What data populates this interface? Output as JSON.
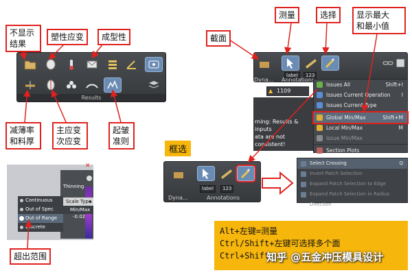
{
  "callouts": {
    "hide_result": "不显示\n结果",
    "plastic_strain": "塑性应变",
    "formability": "成型性",
    "thinning": "减薄率\n和料厚",
    "major_minor_strain": "主应变\n次应变",
    "wrinkle_criterion": "起皱\n准则",
    "section": "截面",
    "measure": "测量",
    "select": "选择",
    "show_minmax": "显示最大\n和最小值",
    "box_select": "框选",
    "out_of_range": "超出范围"
  },
  "toolbars": {
    "results_label": "Results",
    "annotations_label": "Annotations",
    "dyna_label": "Dyna...",
    "issue_count": "1109",
    "counter_value": "123",
    "label_tag": "label"
  },
  "warning_text": "rning: Results & inputs\nata are not consistent!",
  "selection_menu": {
    "items": [
      {
        "label": "Issues All",
        "shortcut": "Shift+I",
        "disabled": false,
        "highlight": false,
        "color": "#6ab04c"
      },
      {
        "label": "Issues Current Operation",
        "shortcut": "I",
        "disabled": false,
        "highlight": false,
        "color": "#5a8fd8"
      },
      {
        "label": "Issues Current Type",
        "shortcut": "",
        "disabled": false,
        "highlight": false,
        "color": "#5a8fd8"
      },
      {
        "label": "Global Min/Max",
        "shortcut": "Shift+M",
        "disabled": false,
        "highlight": true,
        "color": "#e0b030"
      },
      {
        "label": "Local Min/Max",
        "shortcut": "M",
        "disabled": false,
        "highlight": false,
        "color": "#e0b030"
      },
      {
        "label": "Issue Min/Max",
        "shortcut": "",
        "disabled": true,
        "highlight": false,
        "color": "#8a8a8a"
      },
      {
        "label": "Section Plots",
        "shortcut": "",
        "disabled": false,
        "highlight": false,
        "color": "#c06060"
      }
    ]
  },
  "crossing_menu": {
    "items": [
      {
        "label": "Select Crossing",
        "shortcut": "Q",
        "active": true
      },
      {
        "label": "Invert Patch Selection",
        "shortcut": "",
        "active": false
      },
      {
        "label": "Expand Patch Selection to Edge",
        "shortcut": "",
        "active": false
      },
      {
        "label": "Expand Patch Selection in Radius Direction",
        "shortcut": "",
        "active": false
      }
    ]
  },
  "scale_panel": {
    "thinning_label": "Thinning",
    "scale_type_label": "Scale Type",
    "minmax_label": "Min/Max",
    "value": "-0.02",
    "options": [
      {
        "label": "Continuous",
        "checked": false
      },
      {
        "label": "Out of Spec",
        "checked": false
      },
      {
        "label": "Out of Range",
        "checked": true
      },
      {
        "label": "Discrete",
        "checked": false
      }
    ]
  },
  "tips": {
    "line1": "Alt+左键=测量",
    "line2": "Ctrl/Shift+左键可选择多个面",
    "line3": "Ctrl+Shift"
  },
  "watermark": "知乎 @五金冲压模具设计",
  "colors": {
    "accent_red": "#e0211d",
    "tip_bg": "#f7b60b",
    "toolbar_bg": "#3f4246"
  }
}
